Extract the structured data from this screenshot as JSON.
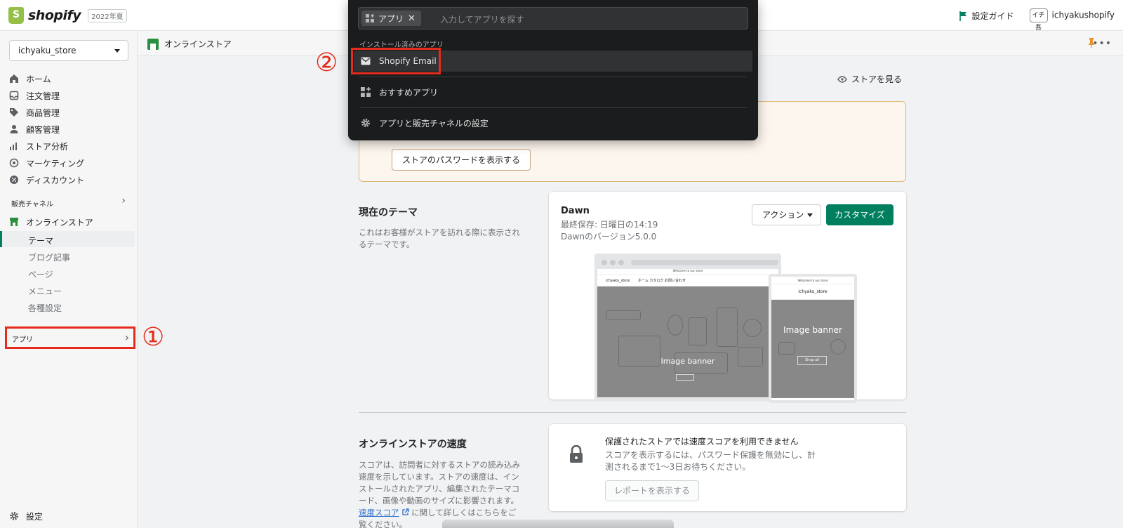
{
  "topbar": {
    "brand": "shopify",
    "edition_badge": "2022年夏",
    "setup_guide": "設定ガイド",
    "avatar_initials": "イチ吾",
    "username": "ichyakushopify"
  },
  "sidebar": {
    "store_name": "ichyaku_store",
    "nav": [
      {
        "label": "ホーム",
        "icon": "home-icon"
      },
      {
        "label": "注文管理",
        "icon": "inbox-icon"
      },
      {
        "label": "商品管理",
        "icon": "tag-icon"
      },
      {
        "label": "顧客管理",
        "icon": "person-icon"
      },
      {
        "label": "ストア分析",
        "icon": "analytics-icon"
      },
      {
        "label": "マーケティング",
        "icon": "target-icon"
      },
      {
        "label": "ディスカウント",
        "icon": "discount-icon"
      }
    ],
    "sales_channels_title": "販売チャネル",
    "online_store": "オンラインストア",
    "sub_items": [
      "テーマ",
      "ブログ記事",
      "ページ",
      "メニュー",
      "各種設定"
    ],
    "apps_label": "アプリ",
    "settings_label": "設定"
  },
  "annotations": {
    "step1": "①",
    "step2": "②"
  },
  "header": {
    "title": "オンラインストア"
  },
  "view_store": "ストアを見る",
  "banner": {
    "password_button": "ストアのパスワードを表示する"
  },
  "theme_section": {
    "title": "現在のテーマ",
    "description_lines": [
      "これはお客様がストアを訪れる際に表示され",
      "るテーマです。"
    ],
    "theme_name": "Dawn",
    "last_saved": "最終保存: 日曜日の14:19",
    "version": "Dawnのバージョン5.0.0",
    "action_button": "アクション",
    "customize_button": "カスタマイズ",
    "preview": {
      "desktop_announcement": "Welcome to our store",
      "desktop_store_name": "ichyaku_store",
      "desktop_nav_links": "ホーム  カタログ  お問い合わせ",
      "desktop_banner_label": "Image banner",
      "mobile_announcement": "Welcome to our store",
      "mobile_store_name": "ichyaku_store",
      "mobile_banner_label": "Image banner",
      "mobile_banner_button": "Shop all"
    }
  },
  "speed_section": {
    "title": "オンラインストアの速度",
    "description_lines": [
      "スコアは、訪問者に対するストアの読み込み",
      "速度を示しています。ストアの速度は、イン",
      "ストールされたアプリ、編集されたテーマコ",
      "ード、画像や動画のサイズに影響されます。"
    ],
    "link_text": "速度スコア",
    "link_suffix": " に関して詳しくはこちらをご",
    "last_line": "覧ください。",
    "card_title": "保護されたストアでは速度スコアを利用できません",
    "card_desc_lines": [
      "スコアを表示するには、パスワード保護を無効にし、計",
      "測されるまで1〜3日お待ちください。"
    ],
    "report_button": "レポートを表示する"
  },
  "app_search": {
    "chip_label": "アプリ",
    "placeholder": "入力してアプリを探す",
    "installed_title": "インストール済みのアプリ",
    "items": [
      "Shopify Email",
      "おすすめアプリ",
      "アプリと販売チャネルの設定"
    ]
  },
  "colors": {
    "brand_green": "#95bf47",
    "primary_button": "#007f5f",
    "annotation_red": "#e52b1b",
    "dropdown_bg": "#1a1c1d"
  }
}
